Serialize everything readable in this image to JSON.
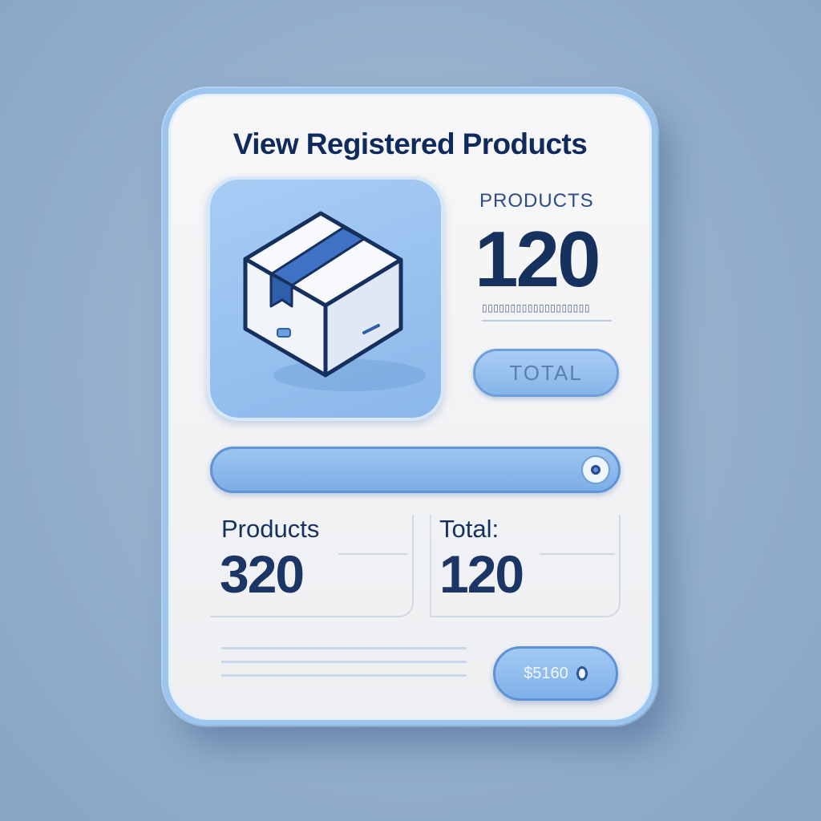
{
  "title": "View Registered Products",
  "summary": {
    "label": "PRODUCTS",
    "value": "120",
    "subtext": "▯▯▯▯▯▯▯▯▯▯▯▯▯▯▯▯▯▯▯",
    "total_button": "TOTAL"
  },
  "search": {
    "placeholder": "",
    "icon": "search-icon"
  },
  "stats": [
    {
      "label": "Products",
      "value": "320"
    },
    {
      "label": "Total:",
      "value": "120"
    }
  ],
  "action_button": {
    "label": "$5160",
    "icon": "dot-icon"
  },
  "icon_tile": {
    "icon": "package-box-icon"
  },
  "colors": {
    "accent": "#8ab7ea",
    "title": "#0f2b5c",
    "border": "#9cc5ef",
    "background": "#93afcb"
  }
}
